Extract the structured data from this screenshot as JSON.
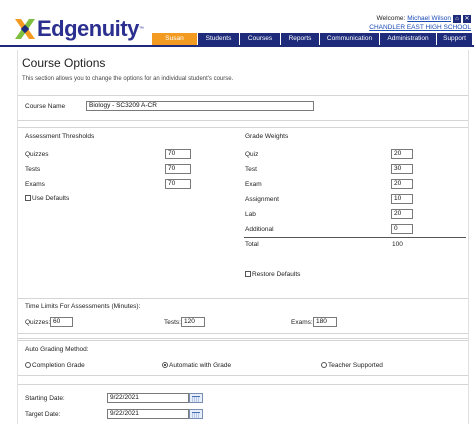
{
  "brand": {
    "name": "Edgenuity",
    "tm": "™",
    "colors": {
      "navy": "#1d2b7a",
      "orange": "#f39b20",
      "green": "#7fbf3f"
    }
  },
  "header": {
    "welcome_label": "Welcome:",
    "user_name": "Michael Wilson",
    "school": "CHANDLER EAST HIGH SCHOOL",
    "icons": [
      "home-icon",
      "logout-icon"
    ]
  },
  "nav": {
    "tabs": [
      "Susan Smith",
      "Students",
      "Courses",
      "Reports",
      "Communication",
      "Administration",
      "Support"
    ]
  },
  "page": {
    "title": "Course Options",
    "description": "This section allows you to change the options for an individual student's course."
  },
  "course": {
    "label": "Course Name",
    "value": "Biology - SC3209 A-CR"
  },
  "thresholds": {
    "heading": "Assessment Thresholds",
    "quizzes_label": "Quizzes",
    "quizzes_value": "70",
    "tests_label": "Tests",
    "tests_value": "70",
    "exams_label": "Exams",
    "exams_value": "70",
    "use_defaults": "Use Defaults"
  },
  "weights": {
    "heading": "Grade Weights",
    "quiz_label": "Quiz",
    "quiz_value": "20",
    "test_label": "Test",
    "test_value": "30",
    "exam_label": "Exam",
    "exam_value": "20",
    "assignment_label": "Assignment",
    "assignment_value": "10",
    "lab_label": "Lab",
    "lab_value": "20",
    "additional_label": "Additional",
    "additional_value": "0",
    "total_label": "Total",
    "total_value": "100",
    "restore_defaults": "Restore Defaults"
  },
  "time_limits": {
    "heading": "Time Limits For Assessments (Minutes):",
    "quizzes_label": "Quizzes:",
    "quizzes_value": "60",
    "tests_label": "Tests:",
    "tests_value": "120",
    "exams_label": "Exams:",
    "exams_value": "180"
  },
  "grading": {
    "heading": "Auto Grading Method:",
    "option_completion": "Completion Grade",
    "option_automatic": "Automatic with Grade",
    "option_teacher": "Teacher Supported",
    "selected": "Automatic with Grade"
  },
  "dates": {
    "start_label": "Starting Date:",
    "start_value": "9/22/2021",
    "target_label": "Target Date:",
    "target_value": "9/22/2021"
  }
}
